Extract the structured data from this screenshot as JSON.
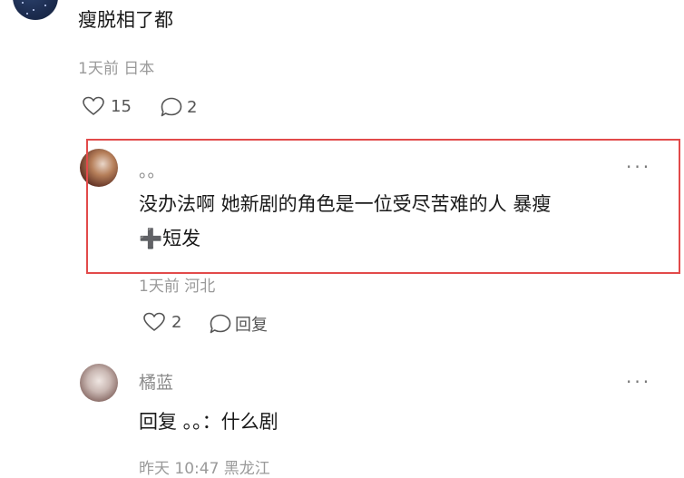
{
  "top_comment": {
    "text": "瘦脱相了都",
    "meta": "1天前 日本",
    "like_count": "15",
    "reply_count": "2"
  },
  "reply_1": {
    "username": "。。",
    "text_line1": "没办法啊 她新剧的角色是一位受尽苦难的人 暴瘦",
    "text_line2": "➕短发",
    "meta": "1天前 河北",
    "like_count": "2",
    "reply_label": "回复"
  },
  "reply_2": {
    "username": "橘蓝",
    "text": "回复 。。：什么剧",
    "meta": "昨天 10:47 黑龙江"
  },
  "more_label": "···",
  "colors": {
    "highlight_border": "#e24a4a",
    "meta_gray": "#9a9a9a"
  }
}
